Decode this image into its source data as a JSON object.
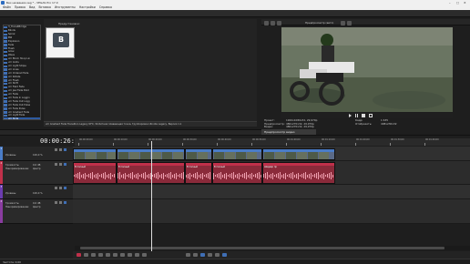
{
  "window": {
    "title": "Без названия.veg * - VEGAS Pro 17.0"
  },
  "menu": [
    "Файл",
    "Правка",
    "Вид",
    "Вставка",
    "Инструменты",
    "Настройки",
    "Справка"
  ],
  "presets_panel": {
    "label": "Предустановки:",
    "effects": [
      "3_TransitBridge",
      "Blinds",
      "Spiral",
      "BW",
      "Explosion",
      "Fade",
      "Flash",
      "Glow",
      "Wave",
      "vm Block Hoop Lin",
      "vm Grids",
      "vm Light Stripe",
      "vm Lines",
      "vm Ordered Fade",
      "vm Rotate",
      "vm Flash",
      "vm Shift",
      "vm Field Fade",
      "vm Jaw Fade Bold",
      "vm Fade",
      "vm Fade In Loggin",
      "vm Fade Out Logg",
      "vm Fade Out Pulse",
      "vm Fade Pulse",
      "vm Gradient Fade",
      "vm Light Fade",
      "vm Slide"
    ],
    "selected_index": 26,
    "selected_label": "vm Gradient Fade",
    "thumb_letter": "B",
    "info": "vm Gradient Fade Transition Legacy OFX, 32-битная плавающая точка, Группировка Ubnote Legacy, Версия 1.1"
  },
  "bottom_tabs": [
    {
      "label": "Медиафайлы проекта",
      "active": false
    },
    {
      "label": "Проводник",
      "active": false
    },
    {
      "label": "Переходы",
      "active": true
    },
    {
      "label": "Видеоэффекты",
      "active": false
    },
    {
      "label": "Генераторы мультимедиа",
      "active": false
    },
    {
      "label": "Project Media",
      "active": false
    }
  ],
  "video_preview": {
    "toolbar_label": "Предпросмотр (авто)",
    "tab_label": "Предпросмотр видео",
    "info": [
      {
        "key": "Проект:",
        "value": "1920x1080x32, 29,970p",
        "key2": "Кадр:",
        "value2": "1 635"
      },
      {
        "key": "Предпросмотр:",
        "value": "480x270x32, 29,970p",
        "key2": "Отобразить:",
        "value2": "408x230x32"
      },
      {
        "key": "Видео:",
        "value": "480x270x32, 29,970p",
        "key2": "",
        "value2": ""
      }
    ]
  },
  "timeline": {
    "timecode": "00:00:26:27",
    "ruler_marks": [
      "00:00:00;00",
      "00:00:10;00",
      "00:00:20;00",
      "00:00:30;00",
      "00:00:40;00",
      "00:00:50;00",
      "00:01:00;00",
      "00:01:10;00",
      "00:01:20;00",
      "00:01:30;00",
      "00:01:40;00"
    ],
    "tracks": [
      {
        "num": "1",
        "type": "video",
        "label": "Уровень:",
        "value": "100,0 %",
        "color": "#4a7cc7"
      },
      {
        "num": "2",
        "type": "audio",
        "label": "Громкость:",
        "value": "0,0 dB",
        "label2": "Панорамирование:",
        "value2": "Центр",
        "color": "#c0304a"
      },
      {
        "num": "3",
        "type": "video",
        "label": "Уровень:",
        "value": "100,0 %",
        "color": "#6c3cb0"
      },
      {
        "num": "4",
        "type": "audio",
        "label": "Громкость:",
        "value": "0,0 dB",
        "label2": "Панорамирование:",
        "value2": "Центр",
        "color": "#8a3ca0"
      }
    ],
    "audio_clip_labels": [
      "В полный",
      "В полный",
      "В полный",
      "В полный",
      "Шедевр пр"
    ],
    "status": "Частота: 0,00"
  },
  "colors": {
    "accent": "#3f6fb5",
    "video_track": "#4a7cc7",
    "audio_track": "#c0304a",
    "playhead": "#dddddd"
  }
}
